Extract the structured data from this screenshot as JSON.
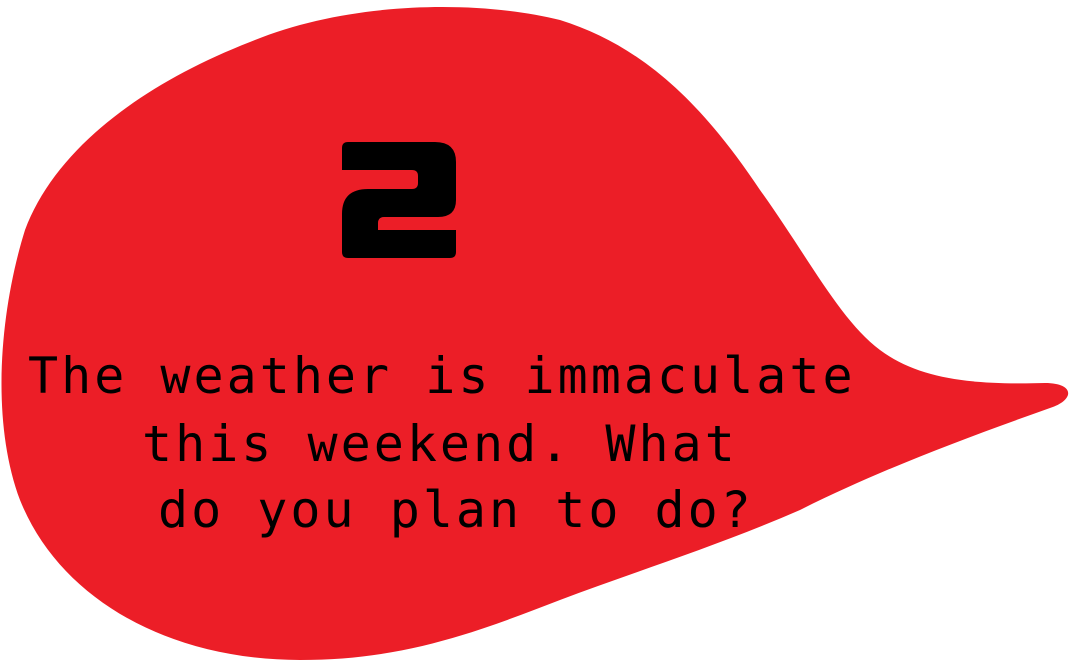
{
  "card": {
    "number": "2",
    "lines": [
      "The weather is immaculate",
      "this weekend. What",
      "do you plan to do?"
    ]
  },
  "colors": {
    "bubble": "#ec1e27",
    "text": "#000000",
    "background": "#ffffff"
  }
}
